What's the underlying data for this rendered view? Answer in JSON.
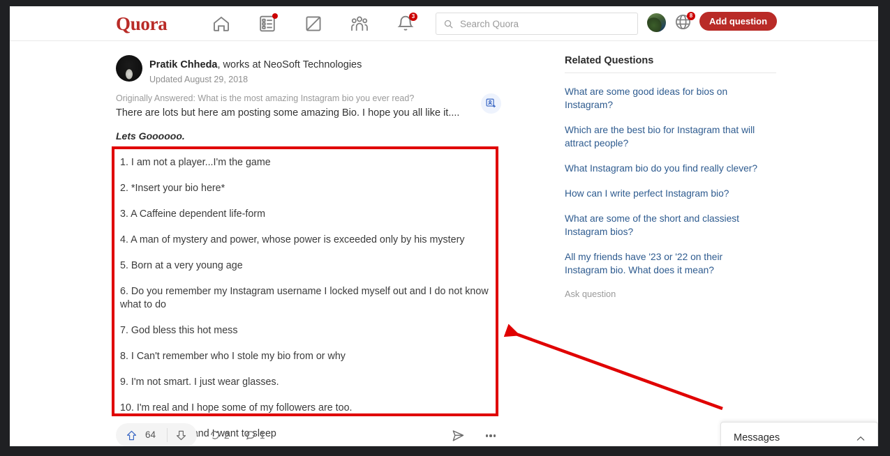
{
  "header": {
    "logo": "Quora",
    "nav_icons": [
      {
        "name": "home-icon",
        "badge": null
      },
      {
        "name": "answer-list-icon",
        "badge": "dot"
      },
      {
        "name": "write-icon",
        "badge": null
      },
      {
        "name": "spaces-icon",
        "badge": null
      },
      {
        "name": "notifications-bell-icon",
        "badge": "3"
      }
    ],
    "search": {
      "placeholder": "Search Quora",
      "value": "",
      "icon": "search-icon"
    },
    "avatar_name": "user-avatar",
    "globe": {
      "icon": "globe-icon",
      "badge": "8"
    },
    "add_question_label": "Add question"
  },
  "answer": {
    "author_name": "Pratik Chheda",
    "author_credential": ", works at NeoSoft Technologies",
    "updated": "Updated August 29, 2018",
    "originally_answered": "Originally Answered: What is the most amazing Instagram bio you ever read?",
    "intro": "There are lots but here am posting some amazing Bio. I hope you all like it....",
    "lets_go": "Lets Goooooo.",
    "follow_user_icon": "add-person-icon",
    "bio_list": [
      "1. I am not a player...I'm the game",
      "2. *Insert your bio here*",
      "3. A Caffeine dependent life-form",
      "4. A man of mystery and power, whose power is exceeded only by his mystery",
      "5. Born at a very young age",
      "6. Do you remember my Instagram username I locked myself out and I do not know what to do",
      "7. God bless this hot mess",
      "8. I Can't remember who I stole my bio from or why",
      "9. I'm not smart. I just wear glasses.",
      "10. I'm real and I hope some of my followers are too.",
      "11. Life is dumb and I want to sleep"
    ],
    "actions": {
      "upvote_label": "64",
      "downvote_label": "",
      "shares_label": "2",
      "comments_label": "1",
      "share_icon": "share-arrow-icon",
      "more_icon": "more-options-icon"
    }
  },
  "sidebar": {
    "title": "Related Questions",
    "questions": [
      "What are some good ideas for bios on Instagram?",
      "Which are the best bio for Instagram that will attract people?",
      "What Instagram bio do you find really clever?",
      "How can I write perfect Instagram bio?",
      "What are some of the short and classiest Instagram bios?",
      "All my friends have '23 or '22 on their Instagram bio. What does it mean?"
    ],
    "ask_question": "Ask question"
  },
  "messages": {
    "label": "Messages",
    "chevron_icon": "chevron-up-icon"
  },
  "annotation": {
    "highlight_color": "#e00000",
    "arrow_color": "#e00000"
  },
  "colors": {
    "brand_red": "#b92b27",
    "link_blue": "#2e5b8f",
    "page_bg": "#ffffff",
    "window_chrome": "#1f2023"
  }
}
